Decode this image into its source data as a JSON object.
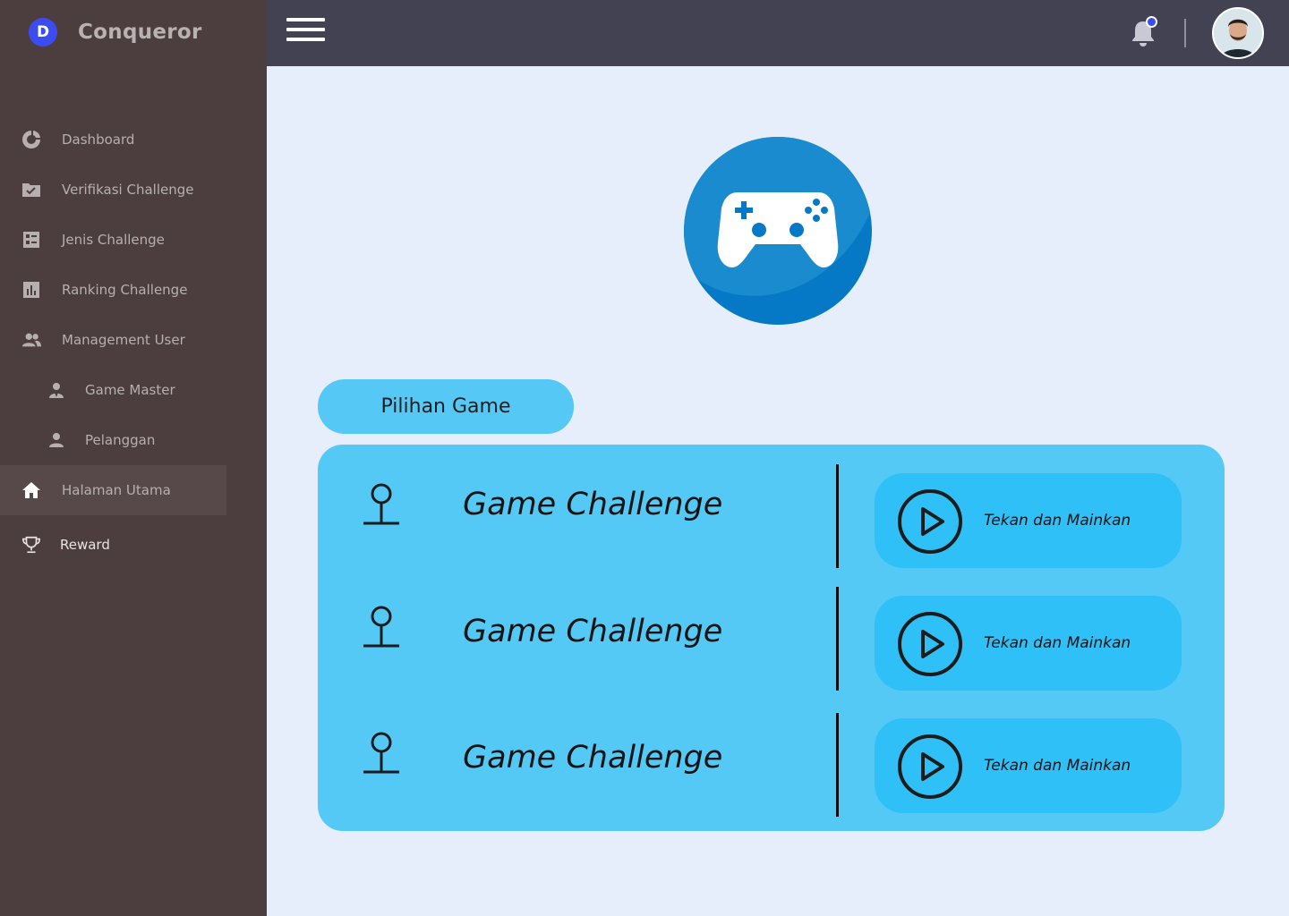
{
  "brand": {
    "logo_letter": "D",
    "name": "Conqueror"
  },
  "sidebar": {
    "items": [
      {
        "label": "Dashboard",
        "icon": "pie-chart-icon"
      },
      {
        "label": "Verifikasi Challenge",
        "icon": "folder-check-icon"
      },
      {
        "label": "Jenis Challenge",
        "icon": "list-grid-icon"
      },
      {
        "label": "Ranking Challenge",
        "icon": "bar-chart-icon"
      },
      {
        "label": "Management User",
        "icon": "users-icon"
      },
      {
        "label": "Game Master",
        "icon": "user-tie-icon"
      },
      {
        "label": "Pelanggan",
        "icon": "user-icon"
      },
      {
        "label": "Halaman Utama",
        "icon": "home-icon",
        "active": true
      },
      {
        "label": "Reward",
        "icon": "trophy-icon"
      }
    ]
  },
  "topbar": {
    "menu_icon": "hamburger-icon",
    "notification_icon": "bell-icon",
    "has_notification": true
  },
  "hero": {
    "icon": "gamepad-icon"
  },
  "section_title": "Pilihan Game",
  "games": [
    {
      "title": "Game Challenge",
      "action_label": "Tekan dan Mainkan",
      "icon": "joystick-icon"
    },
    {
      "title": "Game Challenge",
      "action_label": "Tekan dan Mainkan",
      "icon": "joystick-icon"
    },
    {
      "title": "Game Challenge",
      "action_label": "Tekan dan Mainkan",
      "icon": "joystick-icon"
    }
  ],
  "colors": {
    "sidebar_bg": "#4c3e3e",
    "topbar_bg": "#424253",
    "page_bg": "#e6edfb",
    "panel_bg": "#55c9f6",
    "button_bg": "#2fc0f8",
    "hero_bg": "#0579c5",
    "brand_accent": "#3d4cf0"
  }
}
